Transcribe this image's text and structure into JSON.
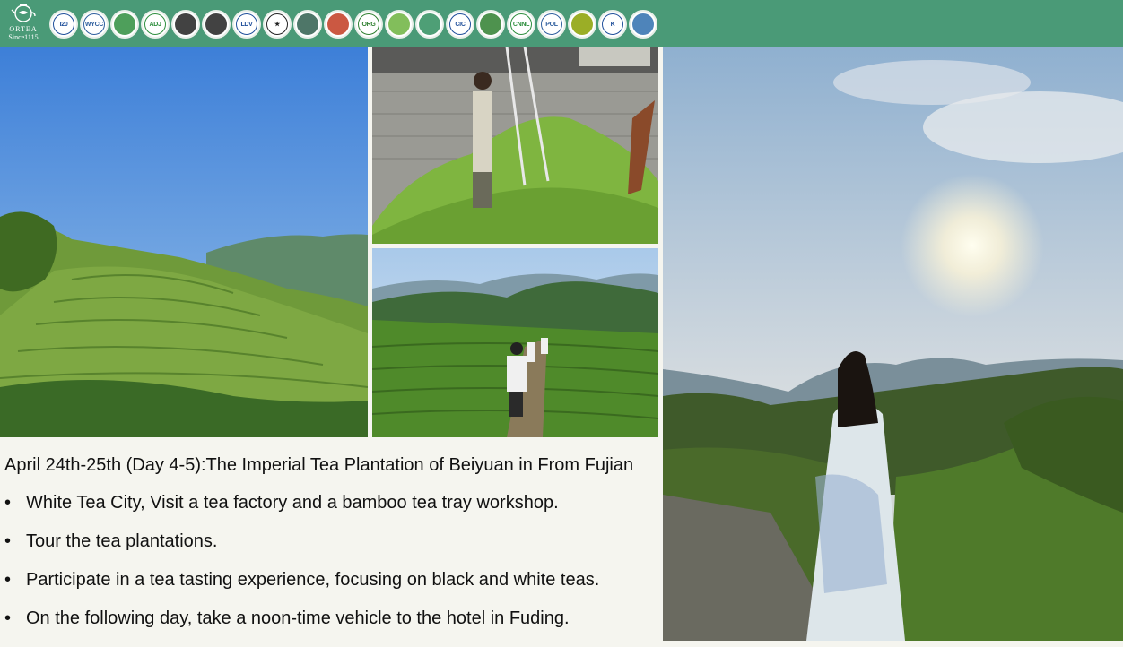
{
  "header": {
    "brand": "ORTEA",
    "since": "Since1115",
    "badges": [
      {
        "icon": "i20-badge-icon",
        "text": "I20",
        "color": "#1f4f9a"
      },
      {
        "icon": "wycc-badge-icon",
        "text": "WYCC",
        "color": "#2f5f9e"
      },
      {
        "icon": "green-seal-badge-icon",
        "text": "",
        "color": "#2f8f3f"
      },
      {
        "icon": "adj-badge-icon",
        "text": "ADJ",
        "color": "#2f8f3f"
      },
      {
        "icon": "stripe-badge-icon",
        "text": "",
        "color": "#222222"
      },
      {
        "icon": "crest-badge-icon",
        "text": "",
        "color": "#222222"
      },
      {
        "icon": "ldv-badge-icon",
        "text": "LDV",
        "color": "#1f4f9a"
      },
      {
        "icon": "star-badge-icon",
        "text": "★",
        "color": "#222222"
      },
      {
        "icon": "emblem-badge-icon",
        "text": "",
        "color": "#2f5f4e"
      },
      {
        "icon": "red-green-seal-badge-icon",
        "text": "",
        "color": "#c23b22"
      },
      {
        "icon": "organic-badge-icon",
        "text": "ORG",
        "color": "#2f7f2f"
      },
      {
        "icon": "eu-leaf-badge-icon",
        "text": "",
        "color": "#6db33f"
      },
      {
        "icon": "oval-cert-badge-icon",
        "text": "",
        "color": "#2f8f5f"
      },
      {
        "icon": "cic-badge-icon",
        "text": "CIC",
        "color": "#1f4f9a"
      },
      {
        "icon": "map-badge-icon",
        "text": "",
        "color": "#2f7f2f"
      },
      {
        "icon": "cnnl-badge-icon",
        "text": "CNNL",
        "color": "#2f8f3f"
      },
      {
        "icon": "pol-badge-icon",
        "text": "POL",
        "color": "#2f5f9e"
      },
      {
        "icon": "leaf-badge-icon",
        "text": "",
        "color": "#8aa000"
      },
      {
        "icon": "k-badge-icon",
        "text": "K",
        "color": "#1f4f9a"
      },
      {
        "icon": "wave-badge-icon",
        "text": "",
        "color": "#2f6fae"
      }
    ]
  },
  "content": {
    "heading": "April 24th-25th (Day 4-5):The Imperial Tea Plantation of Beiyuan in From Fujian",
    "bullets": [
      "White Tea City, Visit a tea factory and a bamboo tea tray workshop.",
      "Tour the tea plantations.",
      "Participate in a tea tasting experience, focusing on black and white teas.",
      "On the following day, take a noon-time vehicle to the hotel in Fuding."
    ],
    "bullet_char": "•"
  },
  "colors": {
    "header_bg": "#4a9a77",
    "page_bg": "#f5f5ef"
  }
}
